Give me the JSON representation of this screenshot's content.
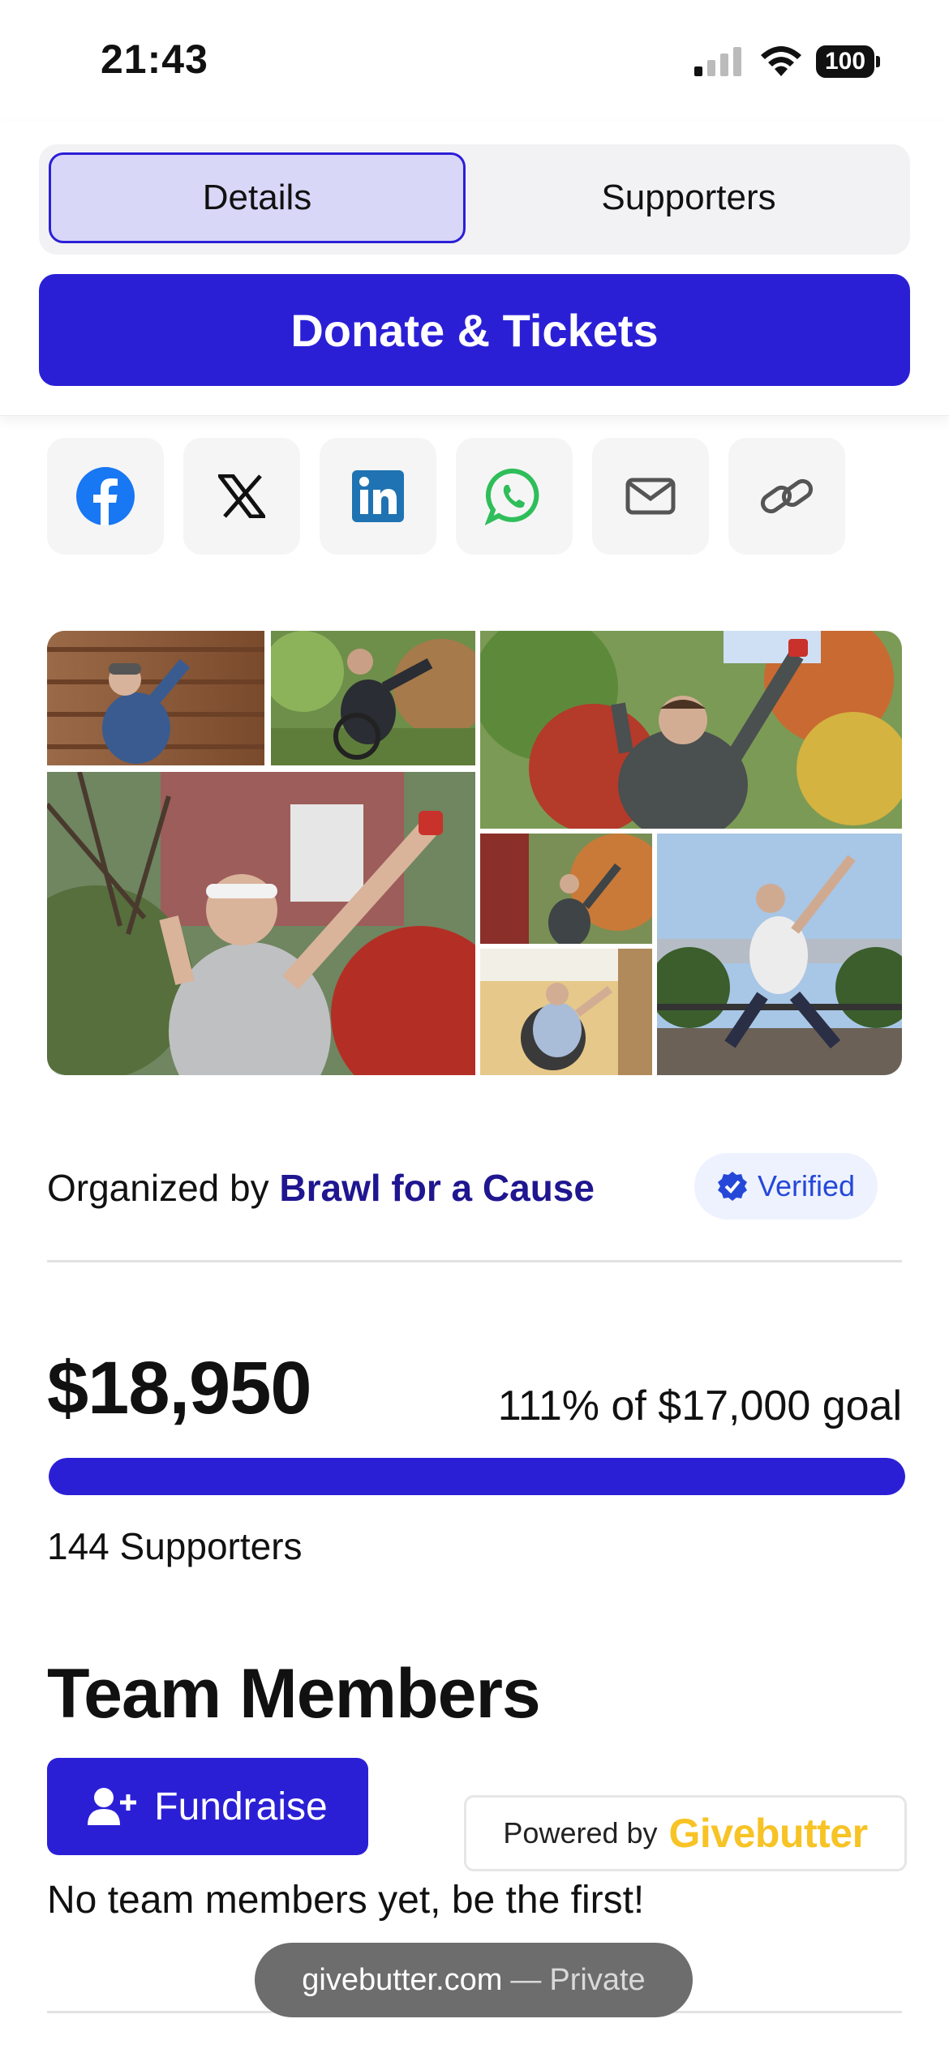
{
  "status_bar": {
    "time": "21:43",
    "battery": "100"
  },
  "tabs": [
    {
      "label": "Details",
      "selected": true
    },
    {
      "label": "Supporters",
      "selected": false
    }
  ],
  "donate_button": {
    "label": "Donate & Tickets"
  },
  "share": [
    {
      "icon": "facebook-icon"
    },
    {
      "icon": "x-icon"
    },
    {
      "icon": "linkedin-icon"
    },
    {
      "icon": "whatsapp-icon"
    },
    {
      "icon": "email-icon"
    },
    {
      "icon": "link-icon"
    }
  ],
  "organizer": {
    "prefix": "Organized by",
    "name": "Brawl for a Cause",
    "badge": "Verified"
  },
  "fundraising": {
    "amount": "$18,950",
    "goal_text": "111% of $17,000 goal",
    "progress_percent": 100,
    "supporters_text": "144 Supporters"
  },
  "team": {
    "title": "Team Members",
    "fundraise_label": "Fundraise",
    "empty_text": "No team members yet, be the first!"
  },
  "powered": {
    "prefix": "Powered by",
    "brand": "Givebutter"
  },
  "url_bar": {
    "domain": "givebutter.com",
    "separator": "—",
    "mode": "Private"
  },
  "colors": {
    "accent": "#2b1fd6",
    "brand_yellow": "#f7c325",
    "organizer_link": "#1f1690",
    "verified": "#2548d9"
  }
}
